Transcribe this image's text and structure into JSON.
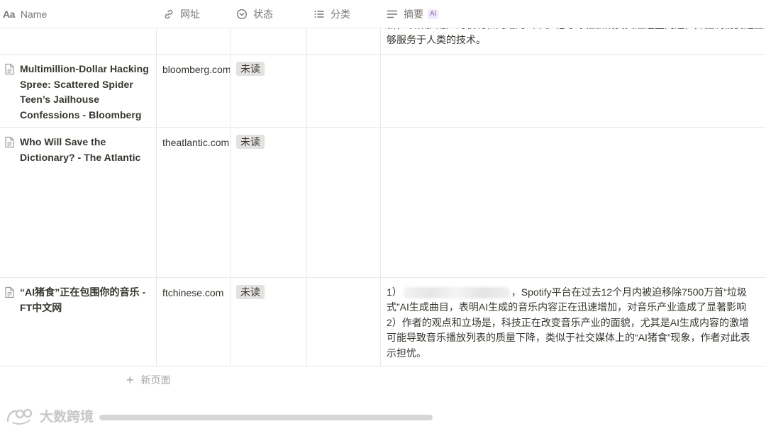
{
  "header": {
    "columns": [
      {
        "label": "Name",
        "icon": "aa-text-icon"
      },
      {
        "label": "网址",
        "icon": "link-icon"
      },
      {
        "label": "状态",
        "icon": "status-icon"
      },
      {
        "label": "分类",
        "icon": "list-icon"
      },
      {
        "label": "摘要",
        "icon": "text-lines-icon",
        "badge": "AI"
      }
    ]
  },
  "top_fragment": {
    "line1": "新，以保护用户的权利和网络的公平。他呼吁社会成员关注这些问题，并强调需要建立",
    "line2": "够服务于人类的技术。"
  },
  "rows": [
    {
      "name": "Multimillion-Dollar Hacking Spree: Scattered Spider Teen’s Jailhouse Confessions - Bloomberg",
      "url": "bloomberg.com",
      "status": "未读",
      "category": "",
      "summary": []
    },
    {
      "name": "Who Will Save the Dictionary? - The Atlantic",
      "url": "theatlantic.com",
      "status": "未读",
      "category": "",
      "summary": []
    },
    {
      "name": "“AI猪食”正在包围你的音乐 - FT中文网",
      "url": "ftchinese.com",
      "status": "未读",
      "category": "",
      "summary": {
        "l1_prefix": "1）",
        "l1_suffix": "，Spotify平台在过去12个月内被迫移除7500万首“垃圾",
        "l2": "式”AI生成曲目，表明AI生成的音乐内容正在迅速增加，对音乐产业造成了显著影响",
        "l3": "2）作者的观点和立场是，科技正在改变音乐产业的面貌，尤其是AI生成内容的激增",
        "l4": "可能导致音乐播放列表的质量下降，类似于社交媒体上的“AI猪食”现象，作者对此表",
        "l5": "示担忧。"
      }
    }
  ],
  "new_page_label": "新页面",
  "watermark_text": "大数跨境",
  "colors": {
    "text": "#37352f",
    "muted": "#787774",
    "border": "#e9e9e7",
    "status_tag_bg": "#e3e2e0",
    "ai_badge_bg": "#f1eafb",
    "ai_badge_text": "#9065b0"
  }
}
